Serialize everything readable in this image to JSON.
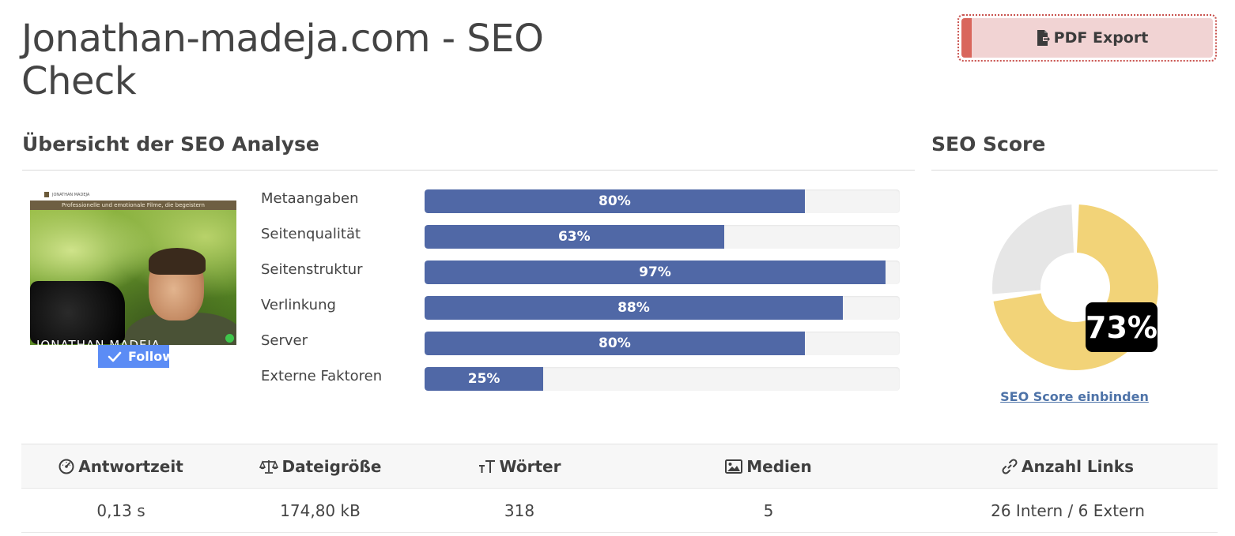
{
  "page": {
    "title": "Jonathan-madeja.com - SEO Check"
  },
  "toolbar": {
    "pdf_label": "PDF Export",
    "pdf_icon": "file-export-icon"
  },
  "overview": {
    "heading": "Übersicht der SEO Analyse",
    "thumbnail": {
      "logo_text": "JONATHAN MADEJA",
      "banner_text": "Professionelle und emotionale Filme, die begeistern",
      "overlay_text": "JONATHAN MADEJA",
      "follow_label": "Follow"
    },
    "metrics": [
      {
        "label": "Metaangaben",
        "value": 80,
        "display": "80%"
      },
      {
        "label": "Seitenqualität",
        "value": 63,
        "display": "63%"
      },
      {
        "label": "Seitenstruktur",
        "value": 97,
        "display": "97%"
      },
      {
        "label": "Verlinkung",
        "value": 88,
        "display": "88%"
      },
      {
        "label": "Server",
        "value": 80,
        "display": "80%"
      },
      {
        "label": "Externe Faktoren",
        "value": 25,
        "display": "25%"
      }
    ],
    "bar_color": "#5068a6",
    "track_color": "#f4f4f4"
  },
  "score": {
    "heading": "SEO Score",
    "value": 73,
    "display": "73%",
    "fill_color": "#f2d378",
    "rest_color": "#e6e6e6",
    "embed_link": "SEO Score einbinden"
  },
  "stats": {
    "columns": [
      {
        "label": "Antwortzeit",
        "icon": "speedometer-icon",
        "value": "0,13 s"
      },
      {
        "label": "Dateigröße",
        "icon": "balance-scale-icon",
        "value": "174,80 kB"
      },
      {
        "label": "Wörter",
        "icon": "text-size-icon",
        "value": "318"
      },
      {
        "label": "Medien",
        "icon": "image-icon",
        "value": "5"
      },
      {
        "label": "Anzahl Links",
        "icon": "link-icon",
        "value": "26 Intern / 6 Extern"
      }
    ]
  }
}
